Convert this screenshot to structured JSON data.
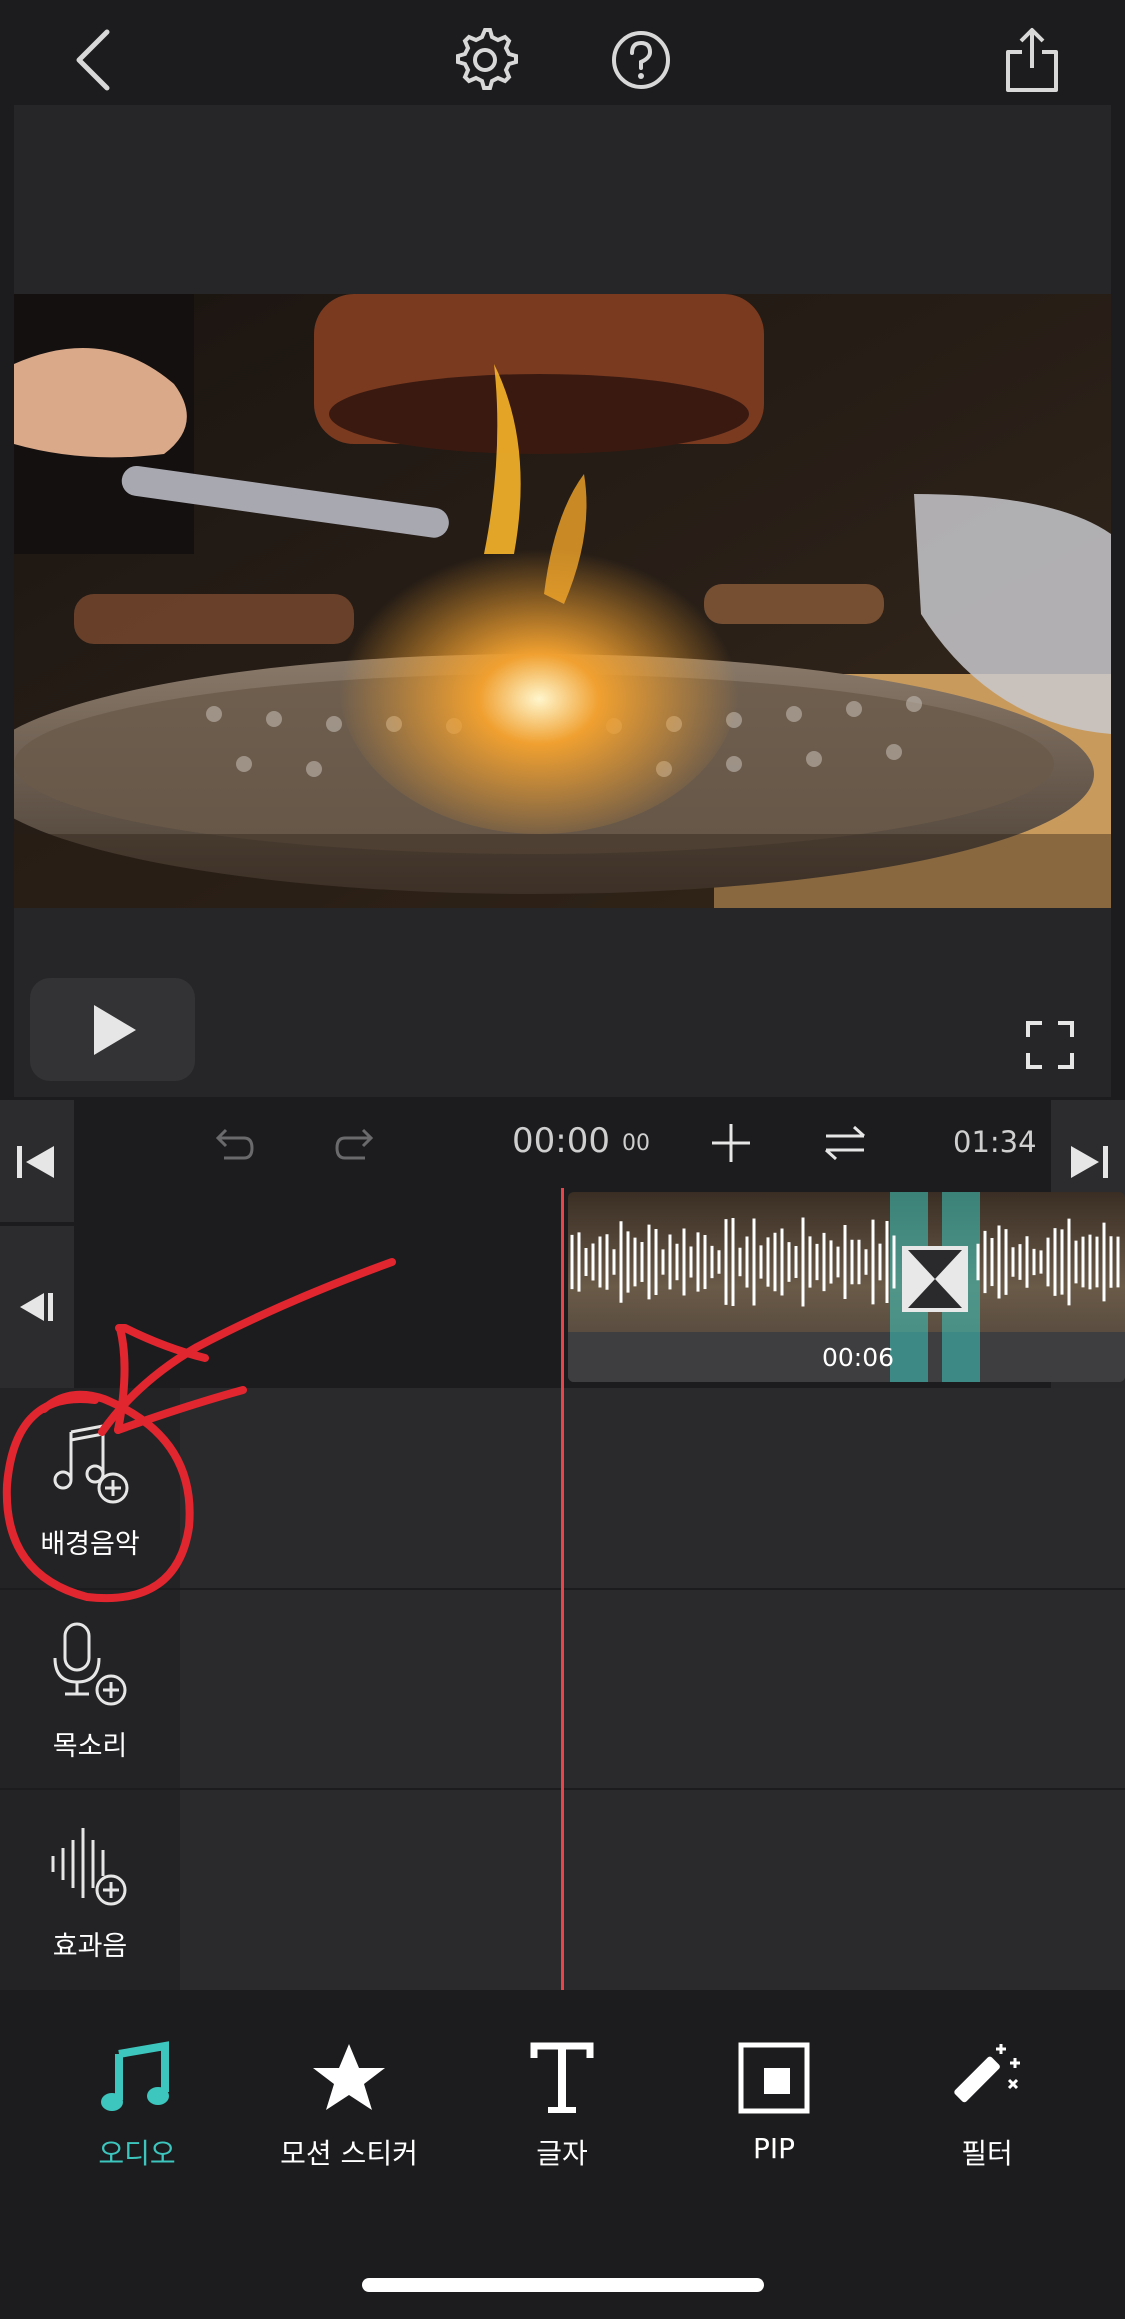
{
  "toolbar": {
    "current_time": "00:00",
    "current_frames": "00",
    "total_time": "01:34"
  },
  "clip": {
    "transition_time": "00:06"
  },
  "tracks": [
    {
      "label": "배경음악",
      "icon": "music-add-icon"
    },
    {
      "label": "목소리",
      "icon": "microphone-add-icon"
    },
    {
      "label": "효과음",
      "icon": "sound-effect-add-icon"
    }
  ],
  "tabs": [
    {
      "label": "오디오",
      "icon": "music-note-icon",
      "active": true
    },
    {
      "label": "모션 스티커",
      "icon": "star-icon",
      "active": false
    },
    {
      "label": "글자",
      "icon": "text-icon",
      "active": false
    },
    {
      "label": "PIP",
      "icon": "pip-icon",
      "active": false
    },
    {
      "label": "필터",
      "icon": "magic-wand-icon",
      "active": false
    }
  ],
  "colors": {
    "accent": "#3cc6bd",
    "playhead": "#e8454a",
    "annotation": "#e2262f"
  }
}
